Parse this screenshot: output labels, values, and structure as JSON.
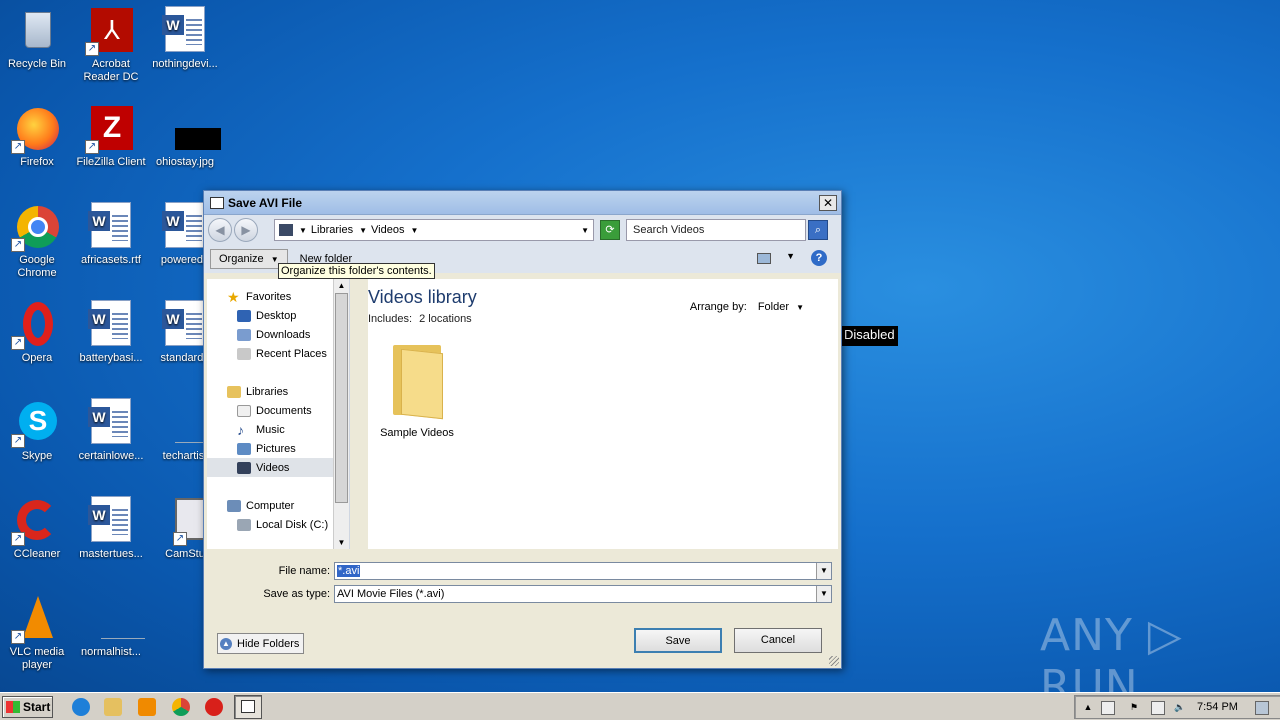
{
  "desktop": {
    "icons": [
      {
        "label_line1": "Recycle Bin",
        "label_line2": ""
      },
      {
        "label_line1": "Acrobat",
        "label_line2": "Reader DC"
      },
      {
        "label_line1": "nothingdevi...",
        "label_line2": ""
      },
      {
        "label_line1": "Firefox",
        "label_line2": ""
      },
      {
        "label_line1": "FileZilla Client",
        "label_line2": ""
      },
      {
        "label_line1": "ohiostay.jpg",
        "label_line2": ""
      },
      {
        "label_line1": "Google",
        "label_line2": "Chrome"
      },
      {
        "label_line1": "africasets.rtf",
        "label_line2": ""
      },
      {
        "label_line1": "poweredp",
        "label_line2": ""
      },
      {
        "label_line1": "Opera",
        "label_line2": ""
      },
      {
        "label_line1": "batterybasi...",
        "label_line2": ""
      },
      {
        "label_line1": "standardp",
        "label_line2": ""
      },
      {
        "label_line1": "Skype",
        "label_line2": ""
      },
      {
        "label_line1": "certainlowe...",
        "label_line2": ""
      },
      {
        "label_line1": "techartist",
        "label_line2": ""
      },
      {
        "label_line1": "CCleaner",
        "label_line2": ""
      },
      {
        "label_line1": "mastertues...",
        "label_line2": ""
      },
      {
        "label_line1": "CamStu",
        "label_line2": ""
      },
      {
        "label_line1": "VLC media",
        "label_line2": "player"
      },
      {
        "label_line1": "normalhist...",
        "label_line2": ""
      }
    ],
    "disabled_tooltip": "Disabled",
    "watermark": "ANY ▷ RUN"
  },
  "dialog": {
    "title": "Save AVI File",
    "close_glyph": "✕",
    "back_glyph": "◀",
    "forward_glyph": "▶",
    "breadcrumb": [
      "Libraries",
      "Videos"
    ],
    "search_placeholder": "Search Videos",
    "toolbar": {
      "organize": "Organize",
      "new_folder": "New folder",
      "organize_tooltip": "Organize this folder's contents.",
      "help": "?"
    },
    "nav": {
      "favorites_header": "Favorites",
      "favorites": [
        "Desktop",
        "Downloads",
        "Recent Places"
      ],
      "libraries_header": "Libraries",
      "libraries": [
        "Documents",
        "Music",
        "Pictures",
        "Videos"
      ],
      "computer_header": "Computer",
      "computer": [
        "Local Disk (C:)"
      ],
      "selected": "Videos"
    },
    "content": {
      "library_title": "Videos library",
      "includes_label": "Includes:",
      "includes_value": "2 locations",
      "arrange_by_label": "Arrange by:",
      "arrange_by_value": "Folder",
      "items": [
        {
          "name": "Sample Videos"
        }
      ]
    },
    "file_name_label": "File name:",
    "file_name_value": "*.avi",
    "save_as_type_label": "Save as type:",
    "save_as_type_value": "AVI Movie Files (*.avi)",
    "hide_folders": "Hide Folders",
    "save": "Save",
    "cancel": "Cancel"
  },
  "taskbar": {
    "start": "Start",
    "clock": "7:54 PM"
  }
}
